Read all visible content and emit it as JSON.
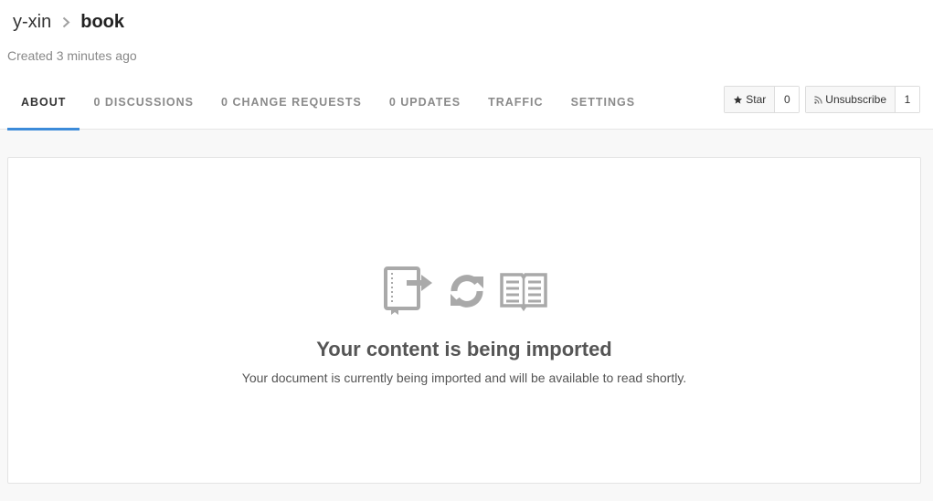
{
  "breadcrumb": {
    "owner": "y-xin",
    "repo": "book"
  },
  "created": "Created 3 minutes ago",
  "tabs": [
    {
      "label": "ABOUT",
      "active": true
    },
    {
      "label": "0 DISCUSSIONS"
    },
    {
      "label": "0 CHANGE REQUESTS"
    },
    {
      "label": "0 UPDATES"
    },
    {
      "label": "TRAFFIC"
    },
    {
      "label": "SETTINGS"
    }
  ],
  "actions": {
    "star_label": "Star",
    "star_count": "0",
    "subscribe_label": "Unsubscribe",
    "subscribe_count": "1"
  },
  "icons": [
    "book-export-icon",
    "sync-icon",
    "open-book-icon",
    "star-icon",
    "rss-icon",
    "chevron-right-icon"
  ],
  "import": {
    "title": "Your content is being imported",
    "message": "Your document is currently being imported and will be available to read shortly."
  },
  "colors": {
    "accent": "#3c8bd9",
    "icon_gray": "#a9a9a9"
  }
}
